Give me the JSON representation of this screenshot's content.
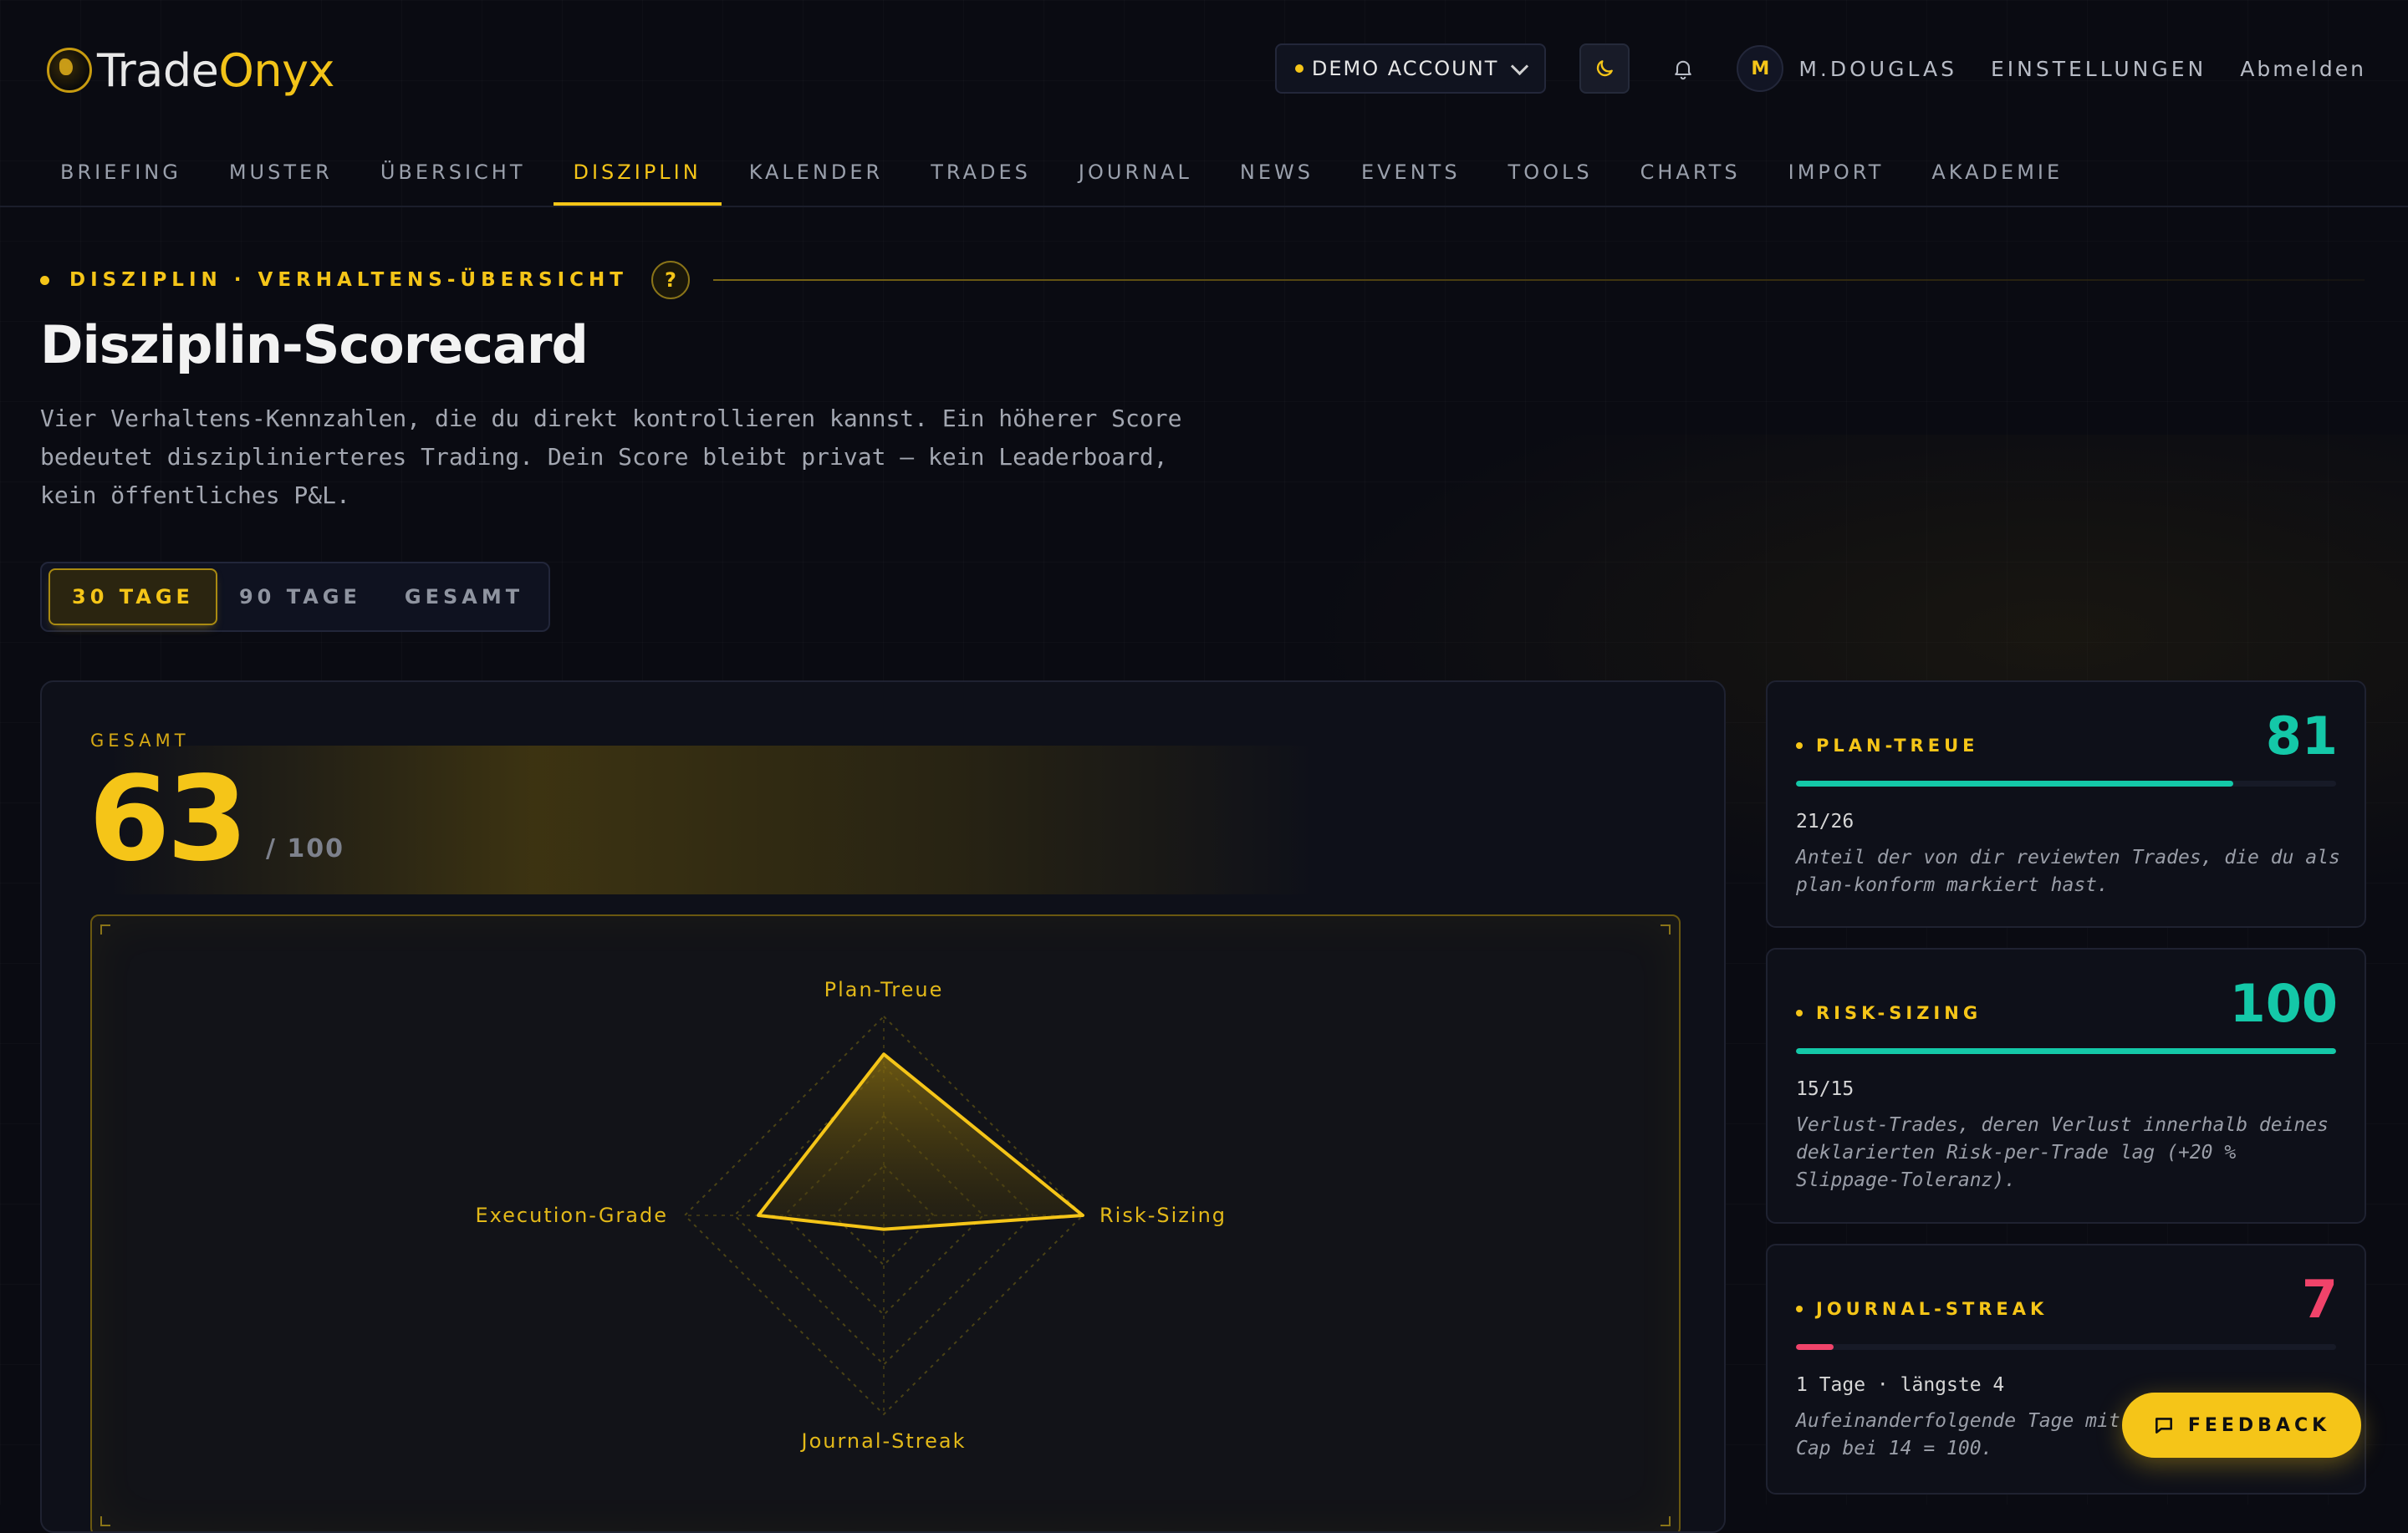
{
  "brand": {
    "name_part1": "Trade",
    "name_part2": "Onyx"
  },
  "header": {
    "account_label": "DEMO ACCOUNT",
    "avatar_initial": "M",
    "username": "M.DOUGLAS",
    "settings_label": "EINSTELLUNGEN",
    "logout_label": "Abmelden"
  },
  "nav": {
    "items": [
      {
        "label": "BRIEFING"
      },
      {
        "label": "MUSTER"
      },
      {
        "label": "ÜBERSICHT"
      },
      {
        "label": "DISZIPLIN",
        "active": true
      },
      {
        "label": "KALENDER"
      },
      {
        "label": "TRADES"
      },
      {
        "label": "JOURNAL"
      },
      {
        "label": "NEWS"
      },
      {
        "label": "EVENTS"
      },
      {
        "label": "TOOLS"
      },
      {
        "label": "CHARTS"
      },
      {
        "label": "IMPORT"
      },
      {
        "label": "AKADEMIE"
      }
    ]
  },
  "page": {
    "eyebrow": "DISZIPLIN · VERHALTENS-ÜBERSICHT",
    "help_label": "?",
    "title": "Disziplin-Scorecard",
    "description": "Vier Verhaltens-Kennzahlen, die du direkt kontrollieren kannst. Ein höherer Score bedeutet disziplinierteres Trading. Dein Score bleibt privat — kein Leaderboard, kein öffentliches P&L."
  },
  "range": {
    "options": [
      {
        "label": "30 TAGE",
        "active": true
      },
      {
        "label": "90 TAGE"
      },
      {
        "label": "GESAMT"
      }
    ]
  },
  "summary": {
    "label": "GESAMT",
    "score": "63",
    "max": "/ 100"
  },
  "radar": {
    "max": 100,
    "axes": [
      {
        "label": "Plan-Treue",
        "value": 81
      },
      {
        "label": "Risk-Sizing",
        "value": 100
      },
      {
        "label": "Journal-Streak",
        "value": 7
      },
      {
        "label": "Execution-Grade",
        "value": 63
      }
    ]
  },
  "metrics": [
    {
      "label": "PLAN-TREUE",
      "value": "81",
      "progress": 0.81,
      "color": "#14c8a8",
      "detail": "21/26",
      "description": "Anteil der von dir reviewten Trades, die du als plan-konform markiert hast."
    },
    {
      "label": "RISK-SIZING",
      "value": "100",
      "progress": 1.0,
      "color": "#14c8a8",
      "detail": "15/15",
      "description": "Verlust-Trades, deren Verlust innerhalb deines deklarierten Risk-per-Trade lag (+20 % Slippage-Toleranz)."
    },
    {
      "label": "JOURNAL-STREAK",
      "value": "7",
      "progress": 0.07,
      "color": "#f0436a",
      "detail": "1 Tage · längste 4",
      "description": "Aufeinanderfolgende Tage mit Journal-Eintrag. Cap bei 14 = 100."
    }
  ],
  "feedback": {
    "label": "FEEDBACK"
  },
  "colors": {
    "accent": "#f5c518",
    "good": "#14c8a8",
    "bad": "#f0436a",
    "background": "#0a0b12"
  }
}
